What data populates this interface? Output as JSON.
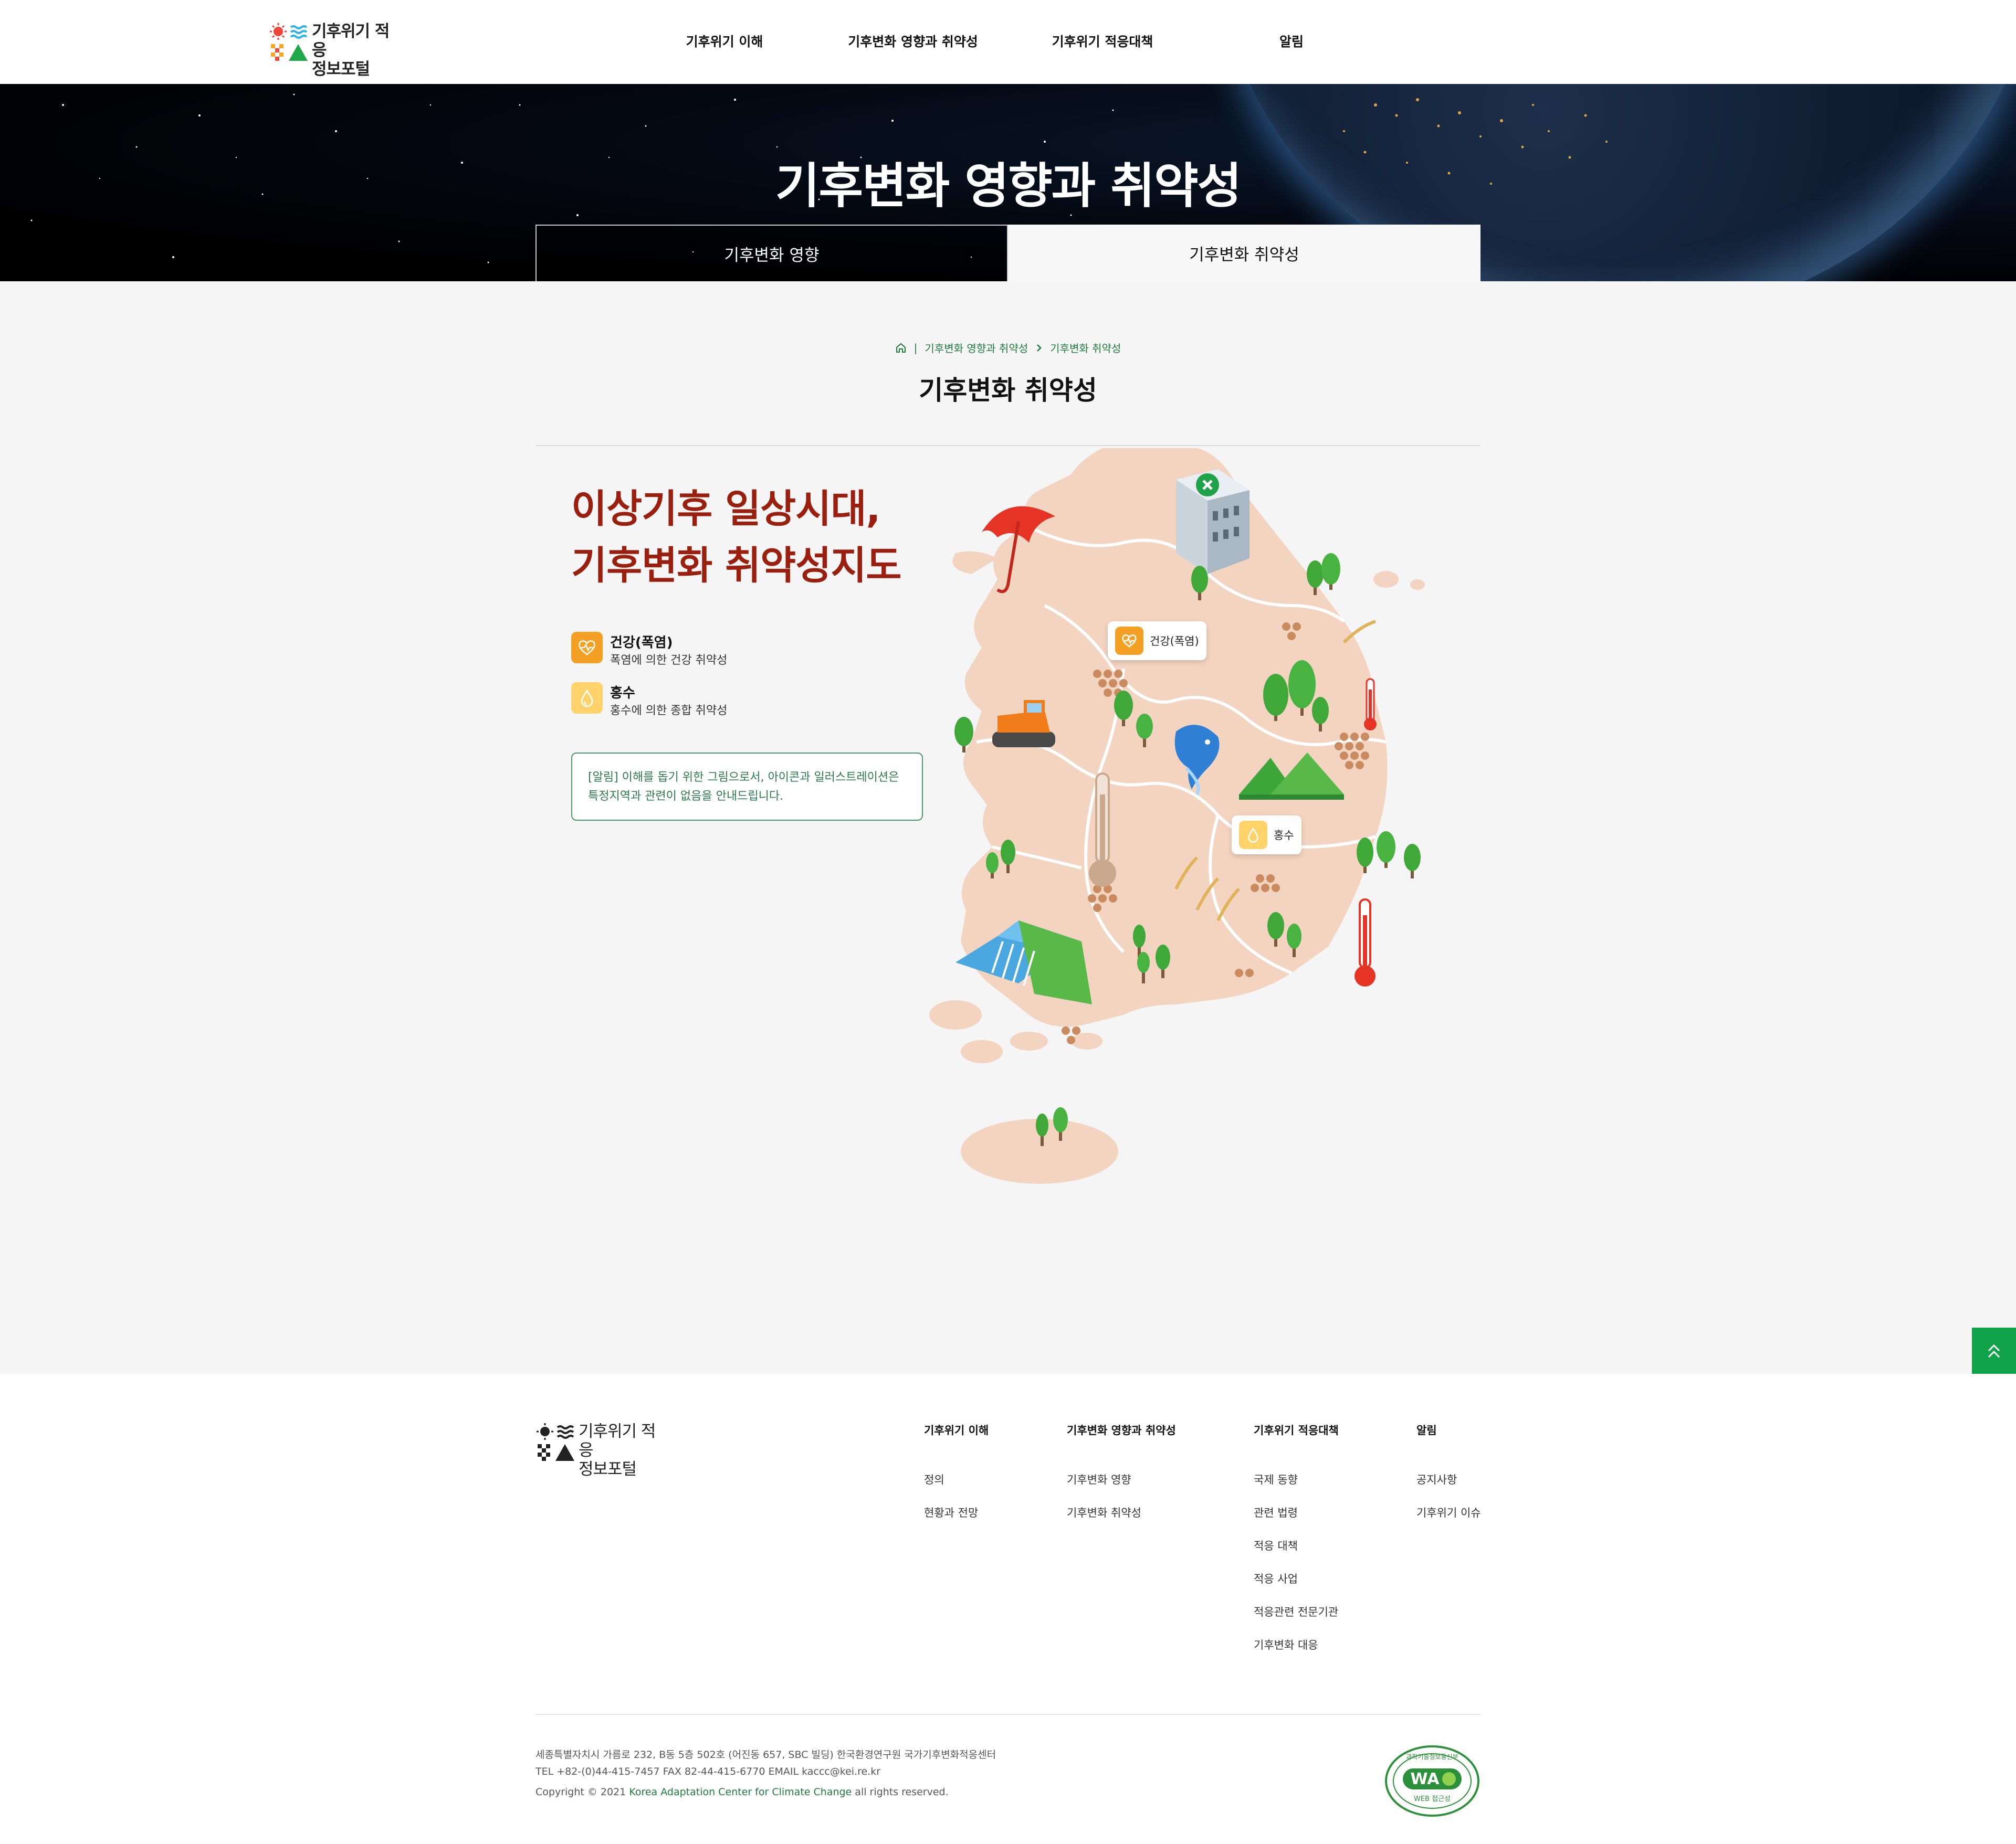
{
  "header": {
    "logo": {
      "line1": "기후위기 적응",
      "line2": "정보포털"
    },
    "nav": [
      "기후위기 이해",
      "기후변화 영향과 취약성",
      "기후위기 적응대책",
      "알림"
    ]
  },
  "hero": {
    "title": "기후변화 영향과 취약성",
    "tabs": [
      {
        "label": "기후변화 영향",
        "active": false
      },
      {
        "label": "기후변화 취약성",
        "active": true
      }
    ]
  },
  "breadcrumb": {
    "separator": "|",
    "items": [
      "기후변화 영향과 취약성",
      "기후변화 취약성"
    ]
  },
  "main": {
    "page_title": "기후변화 취약성",
    "headline_line1": "이상기후 일상시대,",
    "headline_line2": "기후변화 취약성지도",
    "legend": [
      {
        "title": "건강(폭염)",
        "desc": "폭염에 의한 건강 취약성",
        "icon": "heart-pulse-icon",
        "color": "#f4a024"
      },
      {
        "title": "홍수",
        "desc": "홍수에 의한 종합 취약성",
        "icon": "water-drop-icon",
        "color": "#ffd36a"
      }
    ],
    "notice": "[알림] 이해를 돕기 위한 그림으로서, 아이콘과 일러스트레이션은 특정지역과 관련이 없음을 안내드립니다.",
    "map_tags": {
      "health": "건강(폭염)",
      "flood": "홍수"
    }
  },
  "top_button": {
    "icon": "double-chevron-up-icon",
    "color": "#10a349"
  },
  "footer": {
    "logo": {
      "line1": "기후위기 적응",
      "line2": "정보포털"
    },
    "columns": [
      {
        "title": "기후위기 이해",
        "links": [
          "정의",
          "현황과 전망"
        ]
      },
      {
        "title": "기후변화 영향과 취약성",
        "links": [
          "기후변화 영향",
          "기후변화 취약성"
        ]
      },
      {
        "title": "기후위기 적응대책",
        "links": [
          "국제 동향",
          "관련 법령",
          "적응 대책",
          "적응 사업",
          "적응관련 전문기관",
          "기후변화 대응"
        ]
      },
      {
        "title": "알림",
        "links": [
          "공지사항",
          "기후위기 이슈"
        ]
      }
    ],
    "address": "세종특별자치시 가름로 232, B동 5층 502호 (어진동 657, SBC 빌딩) 한국환경연구원 국가기후변화적응센터",
    "contact": "TEL +82-(0)44-415-7457 FAX 82-44-415-6770 EMAIL kaccc@kei.re.kr",
    "copyright_prefix": "Copyright © 2021",
    "copyright_org": "Korea Adaptation Center for Climate Change",
    "copyright_suffix": "all rights reserved.",
    "wa_mark": {
      "top_text": "과학기술정보통신부",
      "badge": "WA",
      "bottom_text": "WEB 접근성"
    }
  }
}
